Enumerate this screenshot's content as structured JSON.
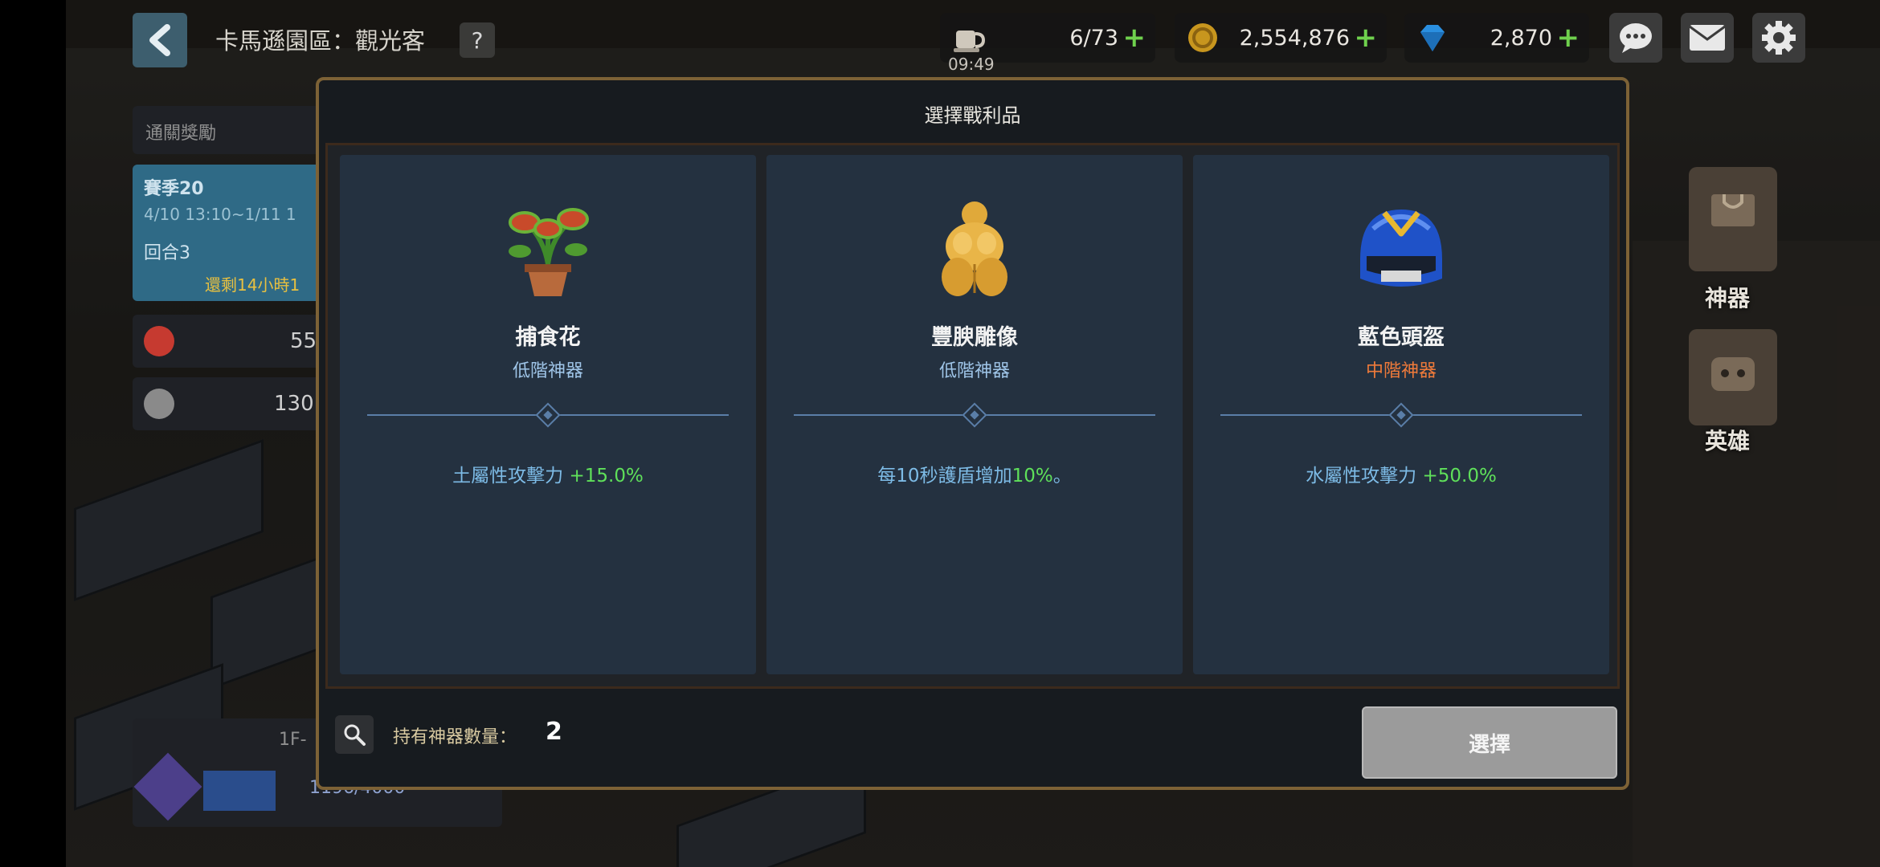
{
  "header": {
    "title": "卡馬遜園區：觀光客",
    "help_label": "?",
    "stamina": {
      "value": "6/73",
      "timer": "09:49",
      "icon": "coffee-cup-icon"
    },
    "gold": {
      "value": "2,554,876",
      "icon": "gold-coin-icon"
    },
    "gems": {
      "value": "2,870",
      "icon": "diamond-icon"
    },
    "buttons": [
      "chat-icon",
      "mail-icon",
      "gear-icon"
    ]
  },
  "left_panel": {
    "rewards_label": "通關獎勵",
    "season_label": "賽季20",
    "season_dates": "4/10 13:10~1/11 1",
    "round_label": "回合3",
    "remaining": "還剩14小時1",
    "stat1": "55",
    "stat2": "130",
    "floor_label": "1F-",
    "progress_text": "1196/4000"
  },
  "side_menu": {
    "artifact_label": "神器",
    "hero_label": "英雄"
  },
  "modal": {
    "title": "選擇戰利品",
    "cards": [
      {
        "name": "捕食花",
        "tier": "低階神器",
        "tier_level": "low",
        "effect_text": "土屬性攻擊力",
        "effect_value": "+15.0%",
        "icon": "venus-flytrap-plant-icon"
      },
      {
        "name": "豐腴雕像",
        "tier": "低階神器",
        "tier_level": "low",
        "effect_text": "每10秒護盾增加",
        "effect_value": "10%",
        "effect_suffix": "。",
        "icon": "golden-statue-icon"
      },
      {
        "name": "藍色頭盔",
        "tier": "中階神器",
        "tier_level": "mid",
        "effect_text": "水屬性攻擊力",
        "effect_value": "+50.0%",
        "icon": "blue-helmet-icon"
      }
    ],
    "owned_label": "持有神器數量：",
    "owned_count": "2",
    "select_label": "選擇"
  },
  "colors": {
    "tier_low": "#9fc5e8",
    "tier_mid": "#ef7a3a",
    "effect_value": "#5fe05a",
    "frame": "#7d6236"
  }
}
